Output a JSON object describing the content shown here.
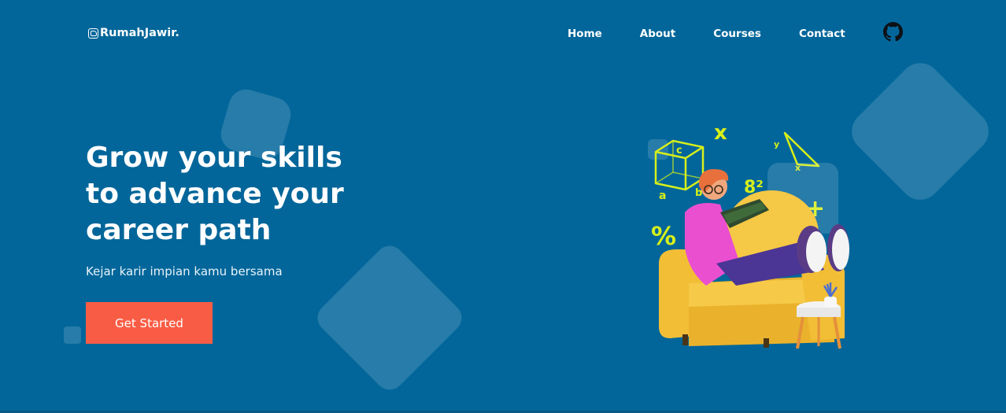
{
  "brand": {
    "name": "RumahJawir."
  },
  "nav": {
    "items": [
      {
        "label": "Home"
      },
      {
        "label": "About"
      },
      {
        "label": "Courses"
      },
      {
        "label": "Contact"
      }
    ]
  },
  "hero": {
    "title_line1": "Grow your skills",
    "title_line2": "to advance your",
    "title_line3": "career path",
    "subtitle": "Kejar karir impian kamu bersama",
    "cta_label": "Get Started"
  },
  "illustration": {
    "glyph_x_top": "x",
    "glyph_c": "c",
    "glyph_a": "a",
    "glyph_b": "b",
    "glyph_y": "y",
    "glyph_x_small": "x",
    "glyph_8sq": "8²",
    "glyph_percent": "%",
    "glyph_plus": "+",
    "glyph_equals": "="
  },
  "colors": {
    "background": "#02669a",
    "accent": "#f95c44",
    "math_glyphs": "#d7ef1b",
    "sofa": "#f2be36",
    "sweater": "#ea4fd0"
  }
}
